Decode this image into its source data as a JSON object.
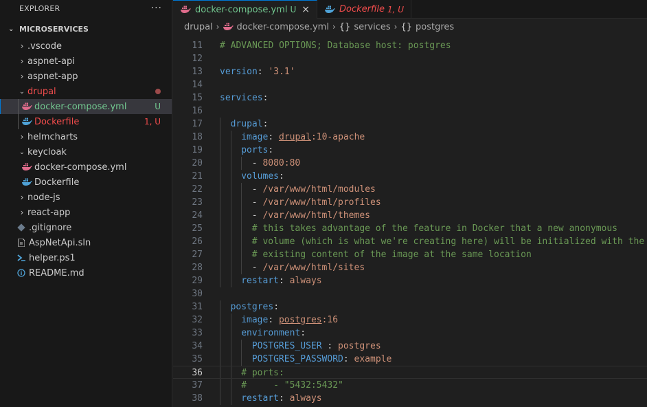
{
  "sidebar": {
    "title": "EXPLORER",
    "more_label": "···",
    "folder": "MICROSERVICES",
    "items": [
      {
        "label": ".vscode",
        "decoration": ""
      },
      {
        "label": "aspnet-api",
        "decoration": ""
      },
      {
        "label": "aspnet-app",
        "decoration": ""
      },
      {
        "label": "drupal",
        "decoration": ""
      },
      {
        "label": "docker-compose.yml",
        "decoration": "U"
      },
      {
        "label": "Dockerfile",
        "decoration": "1, U"
      },
      {
        "label": "helmcharts",
        "decoration": ""
      },
      {
        "label": "keycloak",
        "decoration": ""
      },
      {
        "label": "docker-compose.yml",
        "decoration": ""
      },
      {
        "label": "Dockerfile",
        "decoration": ""
      },
      {
        "label": "node-js",
        "decoration": ""
      },
      {
        "label": "react-app",
        "decoration": ""
      },
      {
        "label": ".gitignore",
        "decoration": ""
      },
      {
        "label": "AspNetApi.sln",
        "decoration": ""
      },
      {
        "label": "helper.ps1",
        "decoration": ""
      },
      {
        "label": "README.md",
        "decoration": ""
      }
    ]
  },
  "tabs": [
    {
      "label": "docker-compose.yml",
      "status": "U",
      "close": "×"
    },
    {
      "label": "Dockerfile",
      "status": "1, U"
    }
  ],
  "breadcrumb": [
    "drupal",
    "docker-compose.yml",
    "services",
    "postgres"
  ],
  "colors": {
    "accent": "#0078d4",
    "untracked": "#73c991",
    "error": "#f14c4c",
    "docker_pink": "#e06c8c",
    "docker_blue": "#4fa3d8"
  },
  "editor": {
    "current_line": "36",
    "lines": [
      {
        "n": "11",
        "text": "# ADVANCED OPTIONS; Database host: postgres"
      },
      {
        "n": "12",
        "text": ""
      },
      {
        "n": "13",
        "key": "version",
        "value": "'3.1'"
      },
      {
        "n": "14",
        "text": ""
      },
      {
        "n": "15",
        "key": "services"
      },
      {
        "n": "16",
        "text": ""
      },
      {
        "n": "17",
        "key": "drupal"
      },
      {
        "n": "18",
        "key": "image",
        "image_name": "drupal",
        "image_tag": ":10-apache"
      },
      {
        "n": "19",
        "key": "ports"
      },
      {
        "n": "20",
        "value": "- 8080:80"
      },
      {
        "n": "21",
        "key": "volumes"
      },
      {
        "n": "22",
        "value": "- /var/www/html/modules"
      },
      {
        "n": "23",
        "value": "- /var/www/html/profiles"
      },
      {
        "n": "24",
        "value": "- /var/www/html/themes"
      },
      {
        "n": "25",
        "text": "# this takes advantage of the feature in Docker that a new anonymous"
      },
      {
        "n": "26",
        "text": "# volume (which is what we're creating here) will be initialized with the"
      },
      {
        "n": "27",
        "text": "# existing content of the image at the same location"
      },
      {
        "n": "28",
        "value": "- /var/www/html/sites"
      },
      {
        "n": "29",
        "key": "restart",
        "value": "always"
      },
      {
        "n": "30",
        "text": ""
      },
      {
        "n": "31",
        "key": "postgres"
      },
      {
        "n": "32",
        "key": "image",
        "image_name": "postgres",
        "image_tag": ":16"
      },
      {
        "n": "33",
        "key": "environment"
      },
      {
        "n": "34",
        "key": "POSTGRES_USER ",
        "value": "postgres"
      },
      {
        "n": "35",
        "key": "POSTGRES_PASSWORD",
        "value": "example"
      },
      {
        "n": "36",
        "text": "# ports:"
      },
      {
        "n": "37",
        "text": "#     - \"5432:5432\""
      },
      {
        "n": "38",
        "key": "restart",
        "value": "always"
      }
    ]
  }
}
